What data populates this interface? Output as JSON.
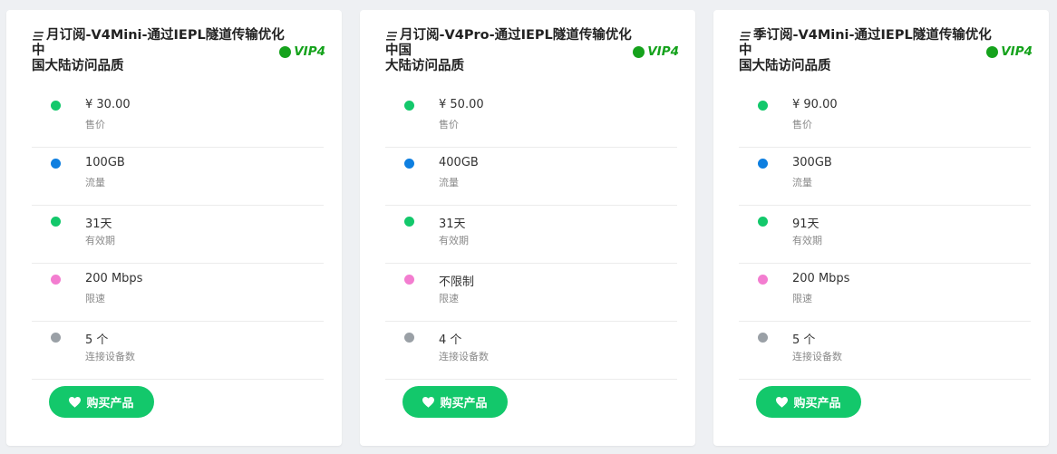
{
  "colors": {
    "green": "#13c86b",
    "blue": "#0e7fe0",
    "pink": "#f37dd0",
    "gray": "#9aa0a6",
    "vip": "#15a21c"
  },
  "buy_label": "购买产品",
  "cards": [
    {
      "title_line1": "月订阅-V4Mini-通过IEPL隧道传输优化中",
      "title_line2": "国大陆访问品质",
      "vip": "VIP4",
      "features": [
        {
          "value": "¥ 30.00",
          "label": "售价",
          "color": "green"
        },
        {
          "value": "100GB",
          "label": "流量",
          "color": "blue"
        },
        {
          "value": "31天",
          "label": "有效期",
          "color": "green"
        },
        {
          "value": "200 Mbps",
          "label": "限速",
          "color": "pink"
        },
        {
          "value": "5 个",
          "label": "连接设备数",
          "color": "gray"
        }
      ]
    },
    {
      "title_line1": "月订阅-V4Pro-通过IEPL隧道传输优化中国",
      "title_line2": "大陆访问品质",
      "vip": "VIP4",
      "features": [
        {
          "value": "¥ 50.00",
          "label": "售价",
          "color": "green"
        },
        {
          "value": "400GB",
          "label": "流量",
          "color": "blue"
        },
        {
          "value": "31天",
          "label": "有效期",
          "color": "green"
        },
        {
          "value": "不限制",
          "label": "限速",
          "color": "pink"
        },
        {
          "value": "4 个",
          "label": "连接设备数",
          "color": "gray"
        }
      ]
    },
    {
      "title_line1": "季订阅-V4Mini-通过IEPL隧道传输优化中",
      "title_line2": "国大陆访问品质",
      "vip": "VIP4",
      "features": [
        {
          "value": "¥ 90.00",
          "label": "售价",
          "color": "green"
        },
        {
          "value": "300GB",
          "label": "流量",
          "color": "blue"
        },
        {
          "value": "91天",
          "label": "有效期",
          "color": "green"
        },
        {
          "value": "200 Mbps",
          "label": "限速",
          "color": "pink"
        },
        {
          "value": "5 个",
          "label": "连接设备数",
          "color": "gray"
        }
      ]
    }
  ]
}
